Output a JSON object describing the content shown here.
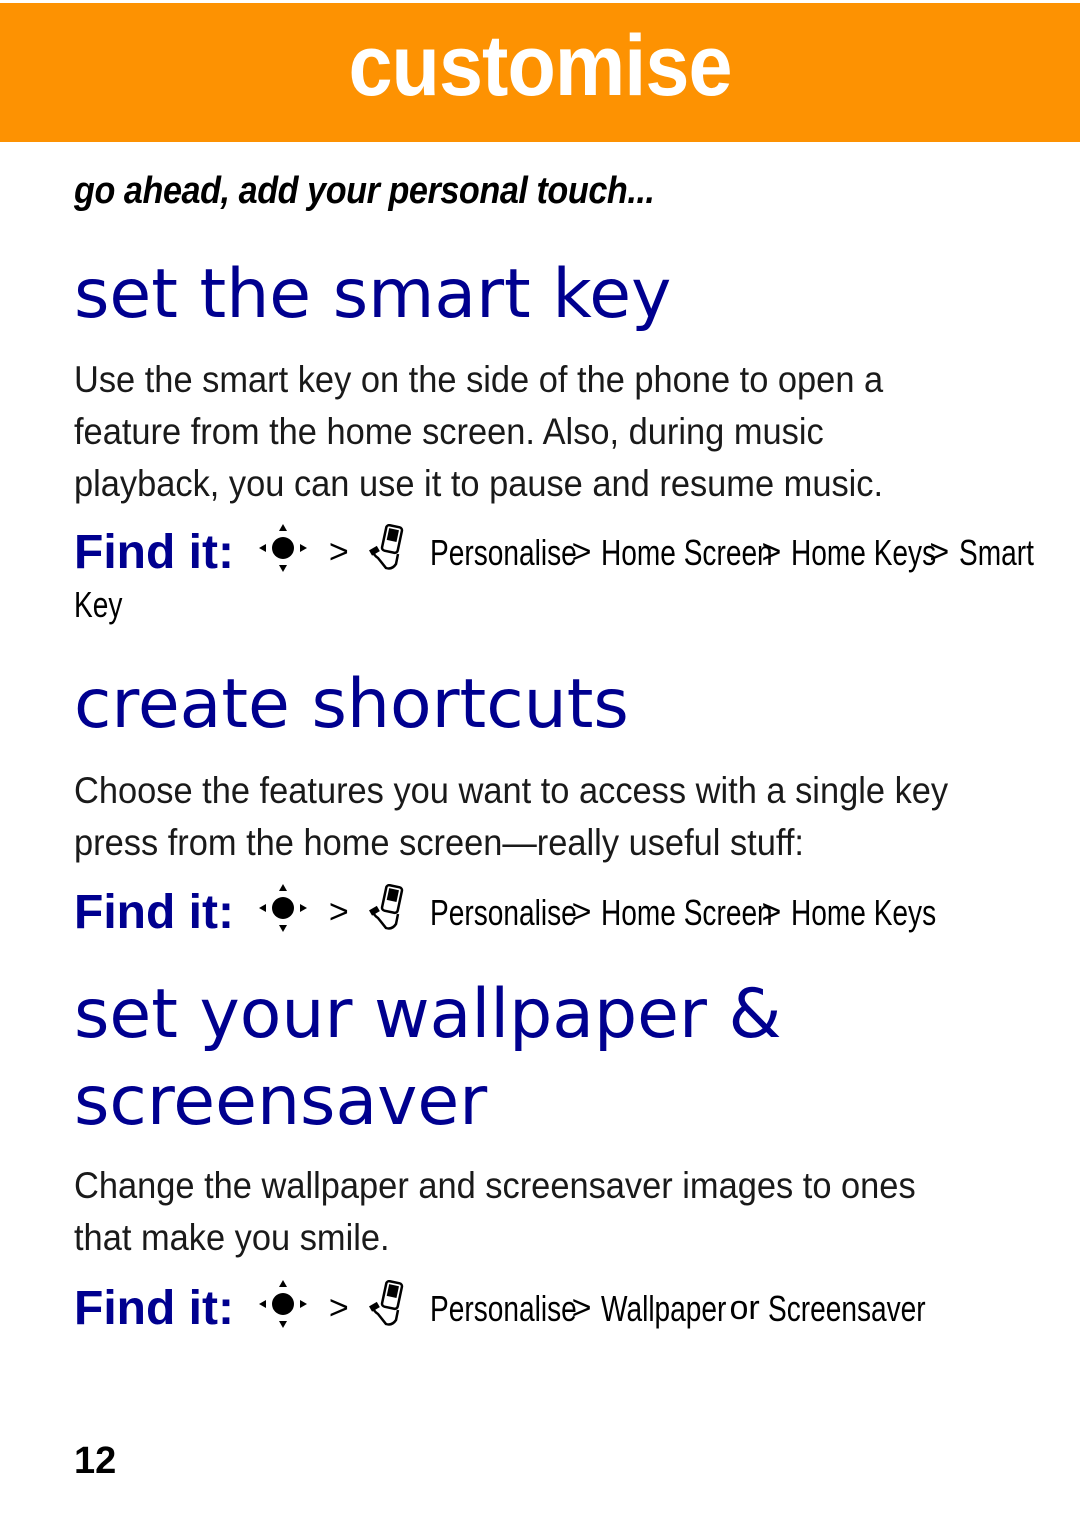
{
  "banner": {
    "title": "customise",
    "color": "#fd9202"
  },
  "tagline": "go ahead, add your personal touch...",
  "sections": [
    {
      "heading": "set the smart key",
      "body": "Use the smart key on the side of the phone to open a feature from the home screen. Also, during music playback, you can use it to pause and resume music.",
      "find_it": {
        "label": "Find it:",
        "path": [
          "Personalise",
          "Home Screen",
          "Home Keys",
          "Smart"
        ],
        "path_continued": "Key"
      }
    },
    {
      "heading": "create shortcuts",
      "body": "Choose the features you want to access with a single key press from the home screen—really useful stuff:",
      "find_it": {
        "label": "Find it:",
        "path": [
          "Personalise",
          "Home Screen",
          "Home Keys"
        ]
      }
    },
    {
      "heading_line1": "set your wallpaper &",
      "heading_line2": "screensaver",
      "body": "Change the wallpaper and screensaver images to ones that make you smile.",
      "find_it": {
        "label": "Find it:",
        "path": [
          "Personalise",
          "Wallpaper"
        ],
        "or_text": "or",
        "alt": "Screensaver"
      }
    }
  ],
  "separator": ">",
  "icons": {
    "nav": "nav-key-icon",
    "menu": "settings-phone-icon"
  },
  "heading_color": "#00008f",
  "page_number": "12"
}
